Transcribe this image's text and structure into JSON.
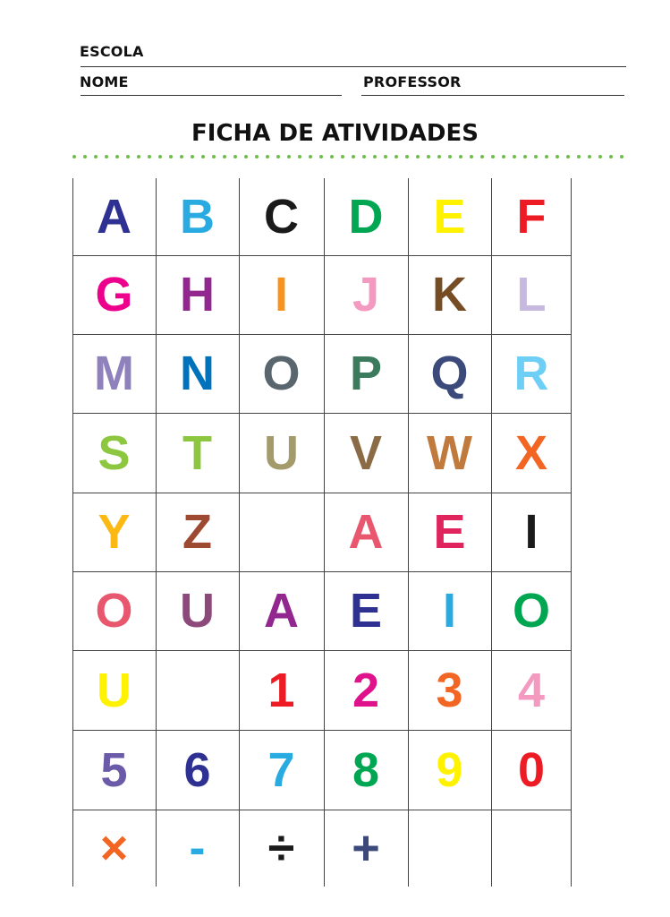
{
  "header": {
    "escola_label": "ESCOLA",
    "nome_label": "NOME",
    "professor_label": "PROFESSOR",
    "title": "FICHA DE ATIVIDADES"
  },
  "colors": {
    "dots": "#6cbf4a",
    "grid_lines": "#444444"
  },
  "grid": {
    "rows": [
      [
        {
          "t": "A",
          "c": "#2e3192"
        },
        {
          "t": "B",
          "c": "#29abe2"
        },
        {
          "t": "C",
          "c": "#1a1a1a"
        },
        {
          "t": "D",
          "c": "#00a651"
        },
        {
          "t": "E",
          "c": "#fff200"
        },
        {
          "t": "F",
          "c": "#ed1c24"
        }
      ],
      [
        {
          "t": "G",
          "c": "#ec008c"
        },
        {
          "t": "H",
          "c": "#92278f"
        },
        {
          "t": "I",
          "c": "#f7941d"
        },
        {
          "t": "J",
          "c": "#f49ac1"
        },
        {
          "t": "K",
          "c": "#754c24"
        },
        {
          "t": "L",
          "c": "#c7b8e0"
        }
      ],
      [
        {
          "t": "M",
          "c": "#8f82bc"
        },
        {
          "t": "N",
          "c": "#0072bc"
        },
        {
          "t": "O",
          "c": "#59666e"
        },
        {
          "t": "P",
          "c": "#3b7a5c"
        },
        {
          "t": "Q",
          "c": "#3b4a7a"
        },
        {
          "t": "R",
          "c": "#6dcff6"
        }
      ],
      [
        {
          "t": "S",
          "c": "#8dc63f"
        },
        {
          "t": "T",
          "c": "#8dc63f"
        },
        {
          "t": "U",
          "c": "#a39b6b"
        },
        {
          "t": "V",
          "c": "#8b6b45"
        },
        {
          "t": "W",
          "c": "#c07a3e"
        },
        {
          "t": "X",
          "c": "#f26522"
        }
      ],
      [
        {
          "t": "Y",
          "c": "#fdb913"
        },
        {
          "t": "Z",
          "c": "#9e4a32"
        },
        {
          "t": "",
          "c": "#000000"
        },
        {
          "t": "A",
          "c": "#e8576d"
        },
        {
          "t": "E",
          "c": "#e0245e"
        },
        {
          "t": "I",
          "c": "#1a1a1a"
        }
      ],
      [
        {
          "t": "O",
          "c": "#e8576d"
        },
        {
          "t": "U",
          "c": "#8c4a7a"
        },
        {
          "t": "A",
          "c": "#92278f"
        },
        {
          "t": "E",
          "c": "#2e3192"
        },
        {
          "t": "I",
          "c": "#29abe2"
        },
        {
          "t": "O",
          "c": "#00a651"
        }
      ],
      [
        {
          "t": "U",
          "c": "#fff200"
        },
        {
          "t": "",
          "c": "#000000"
        },
        {
          "t": "1",
          "c": "#ed1c24"
        },
        {
          "t": "2",
          "c": "#e0128b"
        },
        {
          "t": "3",
          "c": "#f26522"
        },
        {
          "t": "4",
          "c": "#f49ac1"
        }
      ],
      [
        {
          "t": "5",
          "c": "#6a5aa8"
        },
        {
          "t": "6",
          "c": "#2e3192"
        },
        {
          "t": "7",
          "c": "#29abe2"
        },
        {
          "t": "8",
          "c": "#00a651"
        },
        {
          "t": "9",
          "c": "#fff200"
        },
        {
          "t": "0",
          "c": "#ed1c24"
        }
      ],
      [
        {
          "t": "×",
          "c": "#f26522"
        },
        {
          "t": "-",
          "c": "#29abe2"
        },
        {
          "t": "÷",
          "c": "#1a1a1a"
        },
        {
          "t": "+",
          "c": "#3b4a7a"
        },
        {
          "t": "",
          "c": "#000000"
        },
        {
          "t": "",
          "c": "#000000"
        }
      ]
    ]
  }
}
